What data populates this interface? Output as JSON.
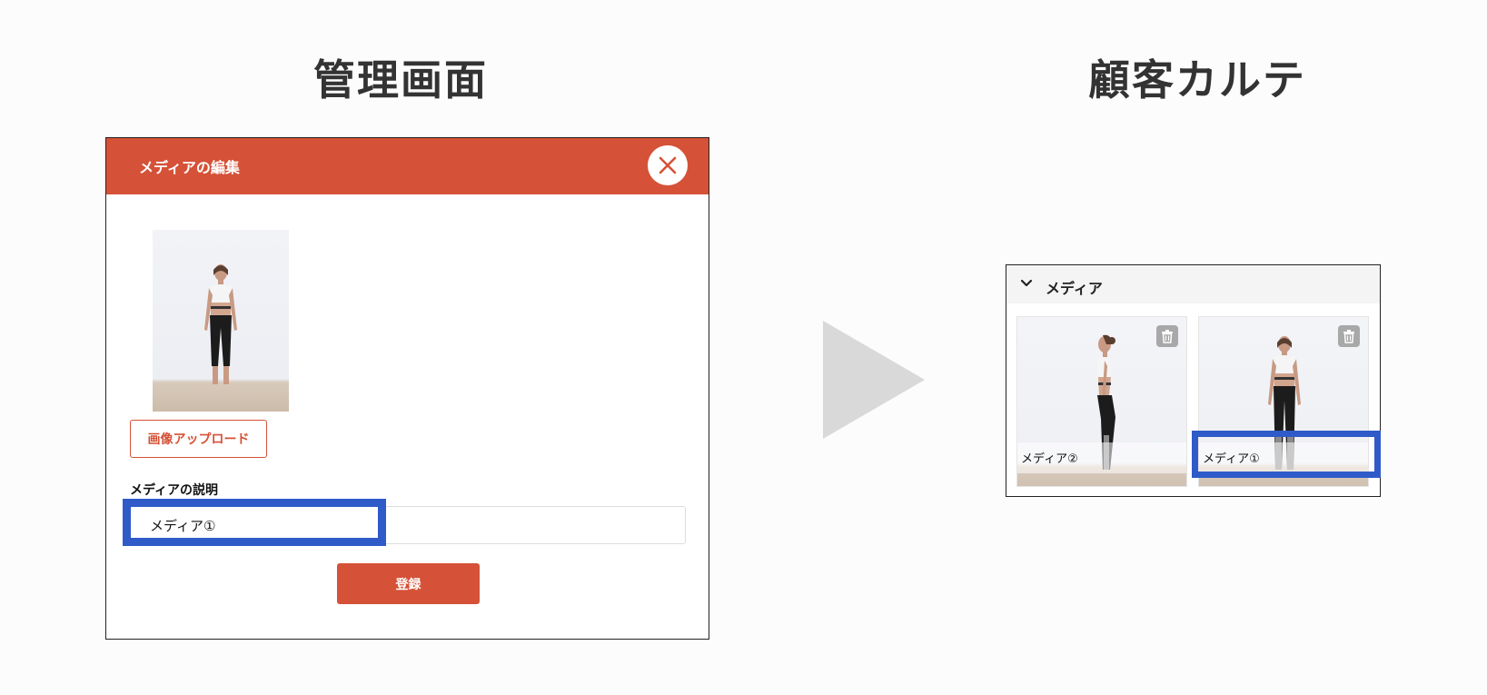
{
  "headings": {
    "left": "管理画面",
    "right": "顧客カルテ"
  },
  "modal": {
    "title": "メディアの編集",
    "upload_label": "画像アップロード",
    "description_label": "メディアの説明",
    "description_value": "メディア①",
    "submit_label": "登録"
  },
  "panel": {
    "title": "メディア",
    "cards": [
      {
        "caption": "メディア②"
      },
      {
        "caption": "メディア①"
      }
    ]
  },
  "colors": {
    "accent": "#d55137",
    "highlight": "#2f5bc9",
    "arrow": "#d9d9d9"
  },
  "icons": [
    "close-icon",
    "chevron-down-icon",
    "trash-icon",
    "play-arrow-icon"
  ]
}
